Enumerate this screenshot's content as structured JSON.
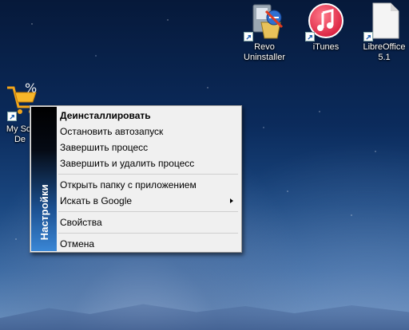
{
  "desktop": {
    "icons": [
      {
        "name": "revo-uninstaller",
        "label_line1": "Revo",
        "label_line2": "Uninstaller"
      },
      {
        "name": "itunes",
        "label_line1": "iTunes",
        "label_line2": ""
      },
      {
        "name": "libreoffice",
        "label_line1": "LibreOffice",
        "label_line2": "5.1"
      },
      {
        "name": "my-software-deals",
        "label_line1": "My Sof",
        "label_line2": "De"
      }
    ]
  },
  "context_menu": {
    "banner_label": "Настройки",
    "items": {
      "uninstall": "Деинсталлировать",
      "disable_autorun": "Остановить автозапуск",
      "kill_process": "Завершить процесс",
      "kill_and_delete": "Завершить и удалить процесс",
      "open_folder": "Открыть папку с приложением",
      "search_google": "Искать в Google",
      "properties": "Свойства",
      "cancel": "Отмена"
    }
  }
}
